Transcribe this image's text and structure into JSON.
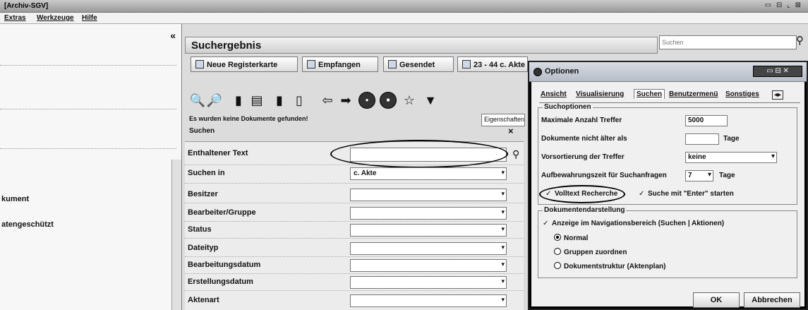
{
  "app": {
    "title": "[Archiv-SGV]",
    "window_controls": "▭ ⊟ ⌞ ⊠"
  },
  "menu": [
    "Extras",
    "Werkzeuge",
    "Hilfe"
  ],
  "left_panel": {
    "collapse": "«",
    "items": [
      "kument",
      "atengeschützt"
    ]
  },
  "header": {
    "title": "Suchergebnis",
    "search_placeholder": "Suchen",
    "search_icon": "magnifier-icon"
  },
  "tabs": [
    "Neue Registerkarte",
    "Empfangen",
    "Gesendet",
    "23 - 44 c. Akte"
  ],
  "toolbar": {
    "eigenschaften": "Eigenschaften",
    "icons": [
      "search-icon",
      "zoom-icon",
      "document-icon",
      "document-export-icon",
      "document-icon",
      "document-icon",
      "arrow-left-icon",
      "arrow-right-icon",
      "circle-icon",
      "stop-icon",
      "star-icon",
      "pin-icon"
    ]
  },
  "result": {
    "message": "Es wurden keine Dokumente gefunden!",
    "section": "Suchen",
    "close": "×"
  },
  "form": {
    "rows": [
      {
        "label": "Enthaltener Text",
        "value": ""
      },
      {
        "label": "Suchen in",
        "value": "c. Akte"
      },
      {
        "label": "Besitzer",
        "value": ""
      },
      {
        "label": "Bearbeiter/Gruppe",
        "value": ""
      },
      {
        "label": "Status",
        "value": ""
      },
      {
        "label": "Dateityp",
        "value": ""
      },
      {
        "label": "Bearbeitungsdatum",
        "value": ""
      },
      {
        "label": "Erstellungsdatum",
        "value": ""
      },
      {
        "label": "Aktenart",
        "value": ""
      }
    ]
  },
  "dialog": {
    "title": "Optionen",
    "controls": "▭ ⊟ ✕",
    "tabs": [
      "Ansicht",
      "Visualisierung",
      "Suchen",
      "Benutzermenü",
      "Sonstiges"
    ],
    "group1": {
      "title": "Suchoptionen",
      "max_hits_label": "Maximale Anzahl Treffer",
      "max_hits_value": "5000",
      "docs_age_label": "Dokumente nicht älter als",
      "docs_age_value": "",
      "docs_age_unit": "Tage",
      "sort_label": "Vorsortierung der Treffer",
      "sort_value": "keine",
      "retention_label": "Aufbewahrungszeit für Suchanfragen",
      "retention_value": "7",
      "retention_unit": "Tage",
      "fulltext_label": "Volltext Recherche",
      "enter_label": "Suche mit \"Enter\" starten"
    },
    "group2": {
      "title": "Dokumentendarstellung",
      "nav_label": "Anzeige im Navigationsbereich (Suchen | Aktionen)",
      "options": [
        "Normal",
        "Gruppen zuordnen",
        "Dokumentstruktur (Aktenplan)"
      ],
      "selected": "Normal"
    },
    "ok": "OK",
    "cancel": "Abbrechen"
  }
}
